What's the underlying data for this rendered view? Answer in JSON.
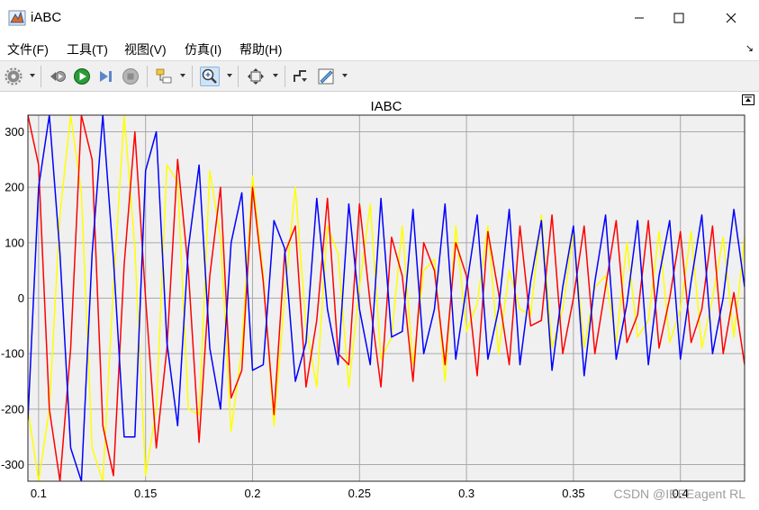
{
  "window": {
    "title": "iABC",
    "app_icon": "matlab-icon",
    "controls": [
      "minimize-icon",
      "maximize-icon",
      "close-icon"
    ]
  },
  "menu": {
    "items": [
      "文件(F)",
      "工具(T)",
      "视图(V)",
      "仿真(I)",
      "帮助(H)"
    ],
    "corner_icon": "restore-menu-icon"
  },
  "toolbar": {
    "icons": [
      "settings-icon",
      "step-back-icon",
      "run-icon",
      "step-forward-icon",
      "stop-icon",
      "highlight-block-icon",
      "zoom-icon",
      "fit-view-icon",
      "triggers-icon",
      "measurements-icon"
    ],
    "active": "zoom-icon"
  },
  "watermark": "CSDN @IEEEagent RL",
  "colors": {
    "phase_a": "#ffff00",
    "phase_b": "#ff0000",
    "phase_c": "#0000ff",
    "plot_bg": "#f0f0f0",
    "grid": "#a9a9a9"
  },
  "chart_data": {
    "type": "line",
    "title": "IABC",
    "xlabel": "",
    "ylabel": "",
    "xlim": [
      0.095,
      0.43
    ],
    "ylim": [
      -330,
      330
    ],
    "xticks": [
      0.1,
      0.15,
      0.2,
      0.25,
      0.3,
      0.35,
      0.4
    ],
    "xtick_labels": [
      "0.1",
      "0.15",
      "0.2",
      "0.25",
      "0.3",
      "0.35",
      "0.4"
    ],
    "yticks": [
      -300,
      -200,
      -100,
      0,
      100,
      200,
      300
    ],
    "ytick_labels": [
      "-300",
      "-200",
      "-100",
      "0",
      "100",
      "200",
      "300"
    ],
    "grid": true,
    "legend": "none",
    "series": [
      {
        "color": "#ffff00",
        "x": [
          0.095,
          0.1,
          0.105,
          0.11,
          0.115,
          0.12,
          0.125,
          0.13,
          0.135,
          0.14,
          0.145,
          0.15,
          0.155,
          0.16,
          0.165,
          0.17,
          0.175,
          0.18,
          0.185,
          0.19,
          0.195,
          0.2,
          0.205,
          0.21,
          0.215,
          0.22,
          0.225,
          0.23,
          0.235,
          0.24,
          0.245,
          0.25,
          0.255,
          0.26,
          0.265,
          0.27,
          0.275,
          0.28,
          0.285,
          0.29,
          0.295,
          0.3,
          0.305,
          0.31,
          0.315,
          0.32,
          0.325,
          0.33,
          0.335,
          0.34,
          0.345,
          0.35,
          0.355,
          0.36,
          0.365,
          0.37,
          0.375,
          0.38,
          0.385,
          0.39,
          0.395,
          0.4,
          0.405,
          0.41,
          0.415,
          0.42,
          0.425,
          0.43
        ],
        "y": [
          -200,
          -330,
          -200,
          150,
          330,
          190,
          -270,
          -330,
          20,
          330,
          90,
          -320,
          -200,
          240,
          210,
          -200,
          -210,
          230,
          110,
          -240,
          -90,
          220,
          40,
          -230,
          0,
          200,
          -50,
          -160,
          130,
          80,
          -160,
          20,
          170,
          -110,
          -70,
          130,
          -120,
          50,
          70,
          -150,
          130,
          -60,
          -10,
          130,
          -100,
          50,
          -20,
          -30,
          150,
          -90,
          -20,
          120,
          -90,
          20,
          40,
          -80,
          100,
          -70,
          -40,
          120,
          -80,
          -20,
          120,
          -90,
          0,
          110,
          -70,
          110
        ]
      },
      {
        "color": "#ff0000",
        "x": [
          0.095,
          0.1,
          0.105,
          0.11,
          0.115,
          0.12,
          0.125,
          0.13,
          0.135,
          0.14,
          0.145,
          0.15,
          0.155,
          0.16,
          0.165,
          0.17,
          0.175,
          0.18,
          0.185,
          0.19,
          0.195,
          0.2,
          0.205,
          0.21,
          0.215,
          0.22,
          0.225,
          0.23,
          0.235,
          0.24,
          0.245,
          0.25,
          0.255,
          0.26,
          0.265,
          0.27,
          0.275,
          0.28,
          0.285,
          0.29,
          0.295,
          0.3,
          0.305,
          0.31,
          0.315,
          0.32,
          0.325,
          0.33,
          0.335,
          0.34,
          0.345,
          0.35,
          0.355,
          0.36,
          0.365,
          0.37,
          0.375,
          0.38,
          0.385,
          0.39,
          0.395,
          0.4,
          0.405,
          0.41,
          0.415,
          0.42,
          0.425,
          0.43
        ],
        "y": [
          330,
          240,
          -200,
          -330,
          -90,
          330,
          250,
          -230,
          -320,
          60,
          300,
          0,
          -270,
          -90,
          250,
          50,
          -260,
          40,
          200,
          -180,
          -130,
          200,
          30,
          -210,
          80,
          130,
          -160,
          -40,
          180,
          -100,
          -120,
          170,
          -10,
          -160,
          110,
          40,
          -150,
          100,
          50,
          -120,
          100,
          40,
          -140,
          120,
          10,
          -120,
          130,
          -50,
          -40,
          150,
          -100,
          0,
          130,
          -100,
          20,
          140,
          -80,
          -30,
          140,
          -90,
          0,
          120,
          -80,
          -20,
          130,
          -100,
          10,
          -120
        ]
      },
      {
        "color": "#0000ff",
        "x": [
          0.095,
          0.1,
          0.105,
          0.11,
          0.115,
          0.12,
          0.125,
          0.13,
          0.135,
          0.14,
          0.145,
          0.15,
          0.155,
          0.16,
          0.165,
          0.17,
          0.175,
          0.18,
          0.185,
          0.19,
          0.195,
          0.2,
          0.205,
          0.21,
          0.215,
          0.22,
          0.225,
          0.23,
          0.235,
          0.24,
          0.245,
          0.25,
          0.255,
          0.26,
          0.265,
          0.27,
          0.275,
          0.28,
          0.285,
          0.29,
          0.295,
          0.3,
          0.305,
          0.31,
          0.315,
          0.32,
          0.325,
          0.33,
          0.335,
          0.34,
          0.345,
          0.35,
          0.355,
          0.36,
          0.365,
          0.37,
          0.375,
          0.38,
          0.385,
          0.39,
          0.395,
          0.4,
          0.405,
          0.41,
          0.415,
          0.42,
          0.425,
          0.43
        ],
        "y": [
          -220,
          200,
          330,
          80,
          -270,
          -330,
          80,
          330,
          70,
          -250,
          -250,
          230,
          300,
          -80,
          -230,
          90,
          240,
          -90,
          -200,
          100,
          190,
          -130,
          -120,
          140,
          90,
          -150,
          -80,
          180,
          -20,
          -120,
          170,
          -20,
          -120,
          180,
          -70,
          -60,
          160,
          -100,
          -20,
          170,
          -110,
          20,
          150,
          -110,
          -20,
          160,
          -120,
          30,
          140,
          -130,
          20,
          130,
          -140,
          30,
          150,
          -110,
          -10,
          140,
          -120,
          40,
          140,
          -110,
          30,
          150,
          -100,
          0,
          160,
          20
        ]
      }
    ]
  }
}
